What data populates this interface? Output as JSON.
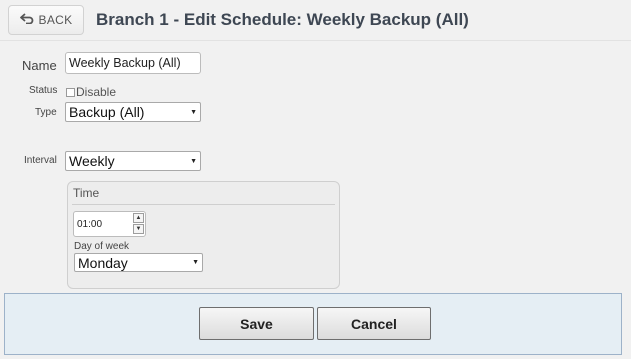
{
  "header": {
    "back_label": "BACK",
    "title": "Branch 1 - Edit Schedule: Weekly Backup (All)"
  },
  "form": {
    "name_label": "Name",
    "name_value": "Weekly Backup (All)",
    "status_label": "Status",
    "disable_label": "Disable",
    "disable_checked": false,
    "type_label": "Type",
    "type_value": "Backup (All)",
    "interval_label": "Interval",
    "interval_value": "Weekly",
    "time_section": {
      "legend": "Time",
      "time_value": "01:00",
      "day_of_week_label": "Day of week",
      "day_of_week_value": "Monday"
    }
  },
  "footer": {
    "save_label": "Save",
    "cancel_label": "Cancel"
  },
  "colors": {
    "background": "#f1f1f1",
    "title": "#3e4753",
    "footer_bg": "#e5eef4",
    "footer_border": "#9db2c9"
  }
}
